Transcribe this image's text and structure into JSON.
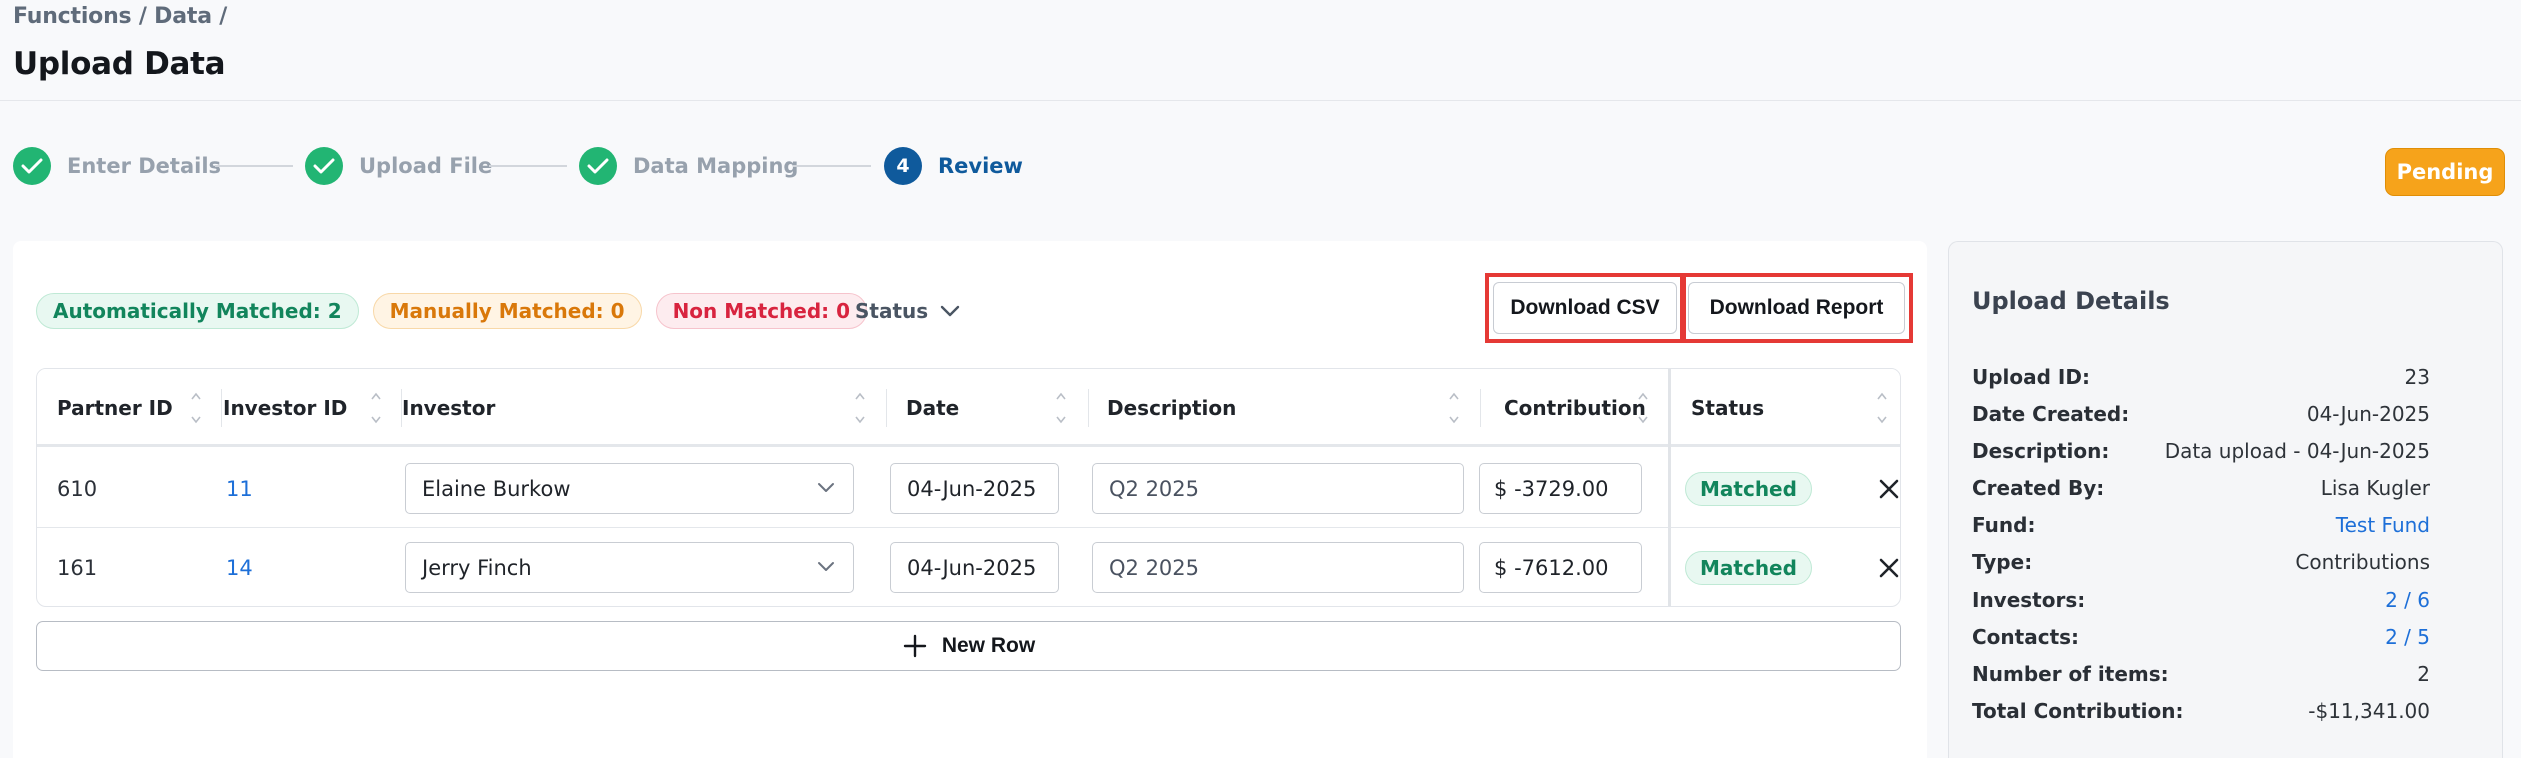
{
  "header": {
    "breadcrumb": "Functions / Data /",
    "title": "Upload Data"
  },
  "stepper": {
    "steps": [
      {
        "label": "Enter Details",
        "state": "done"
      },
      {
        "label": "Upload File",
        "state": "done"
      },
      {
        "label": "Data Mapping",
        "state": "done"
      },
      {
        "label": "Review",
        "state": "current",
        "number": "4"
      }
    ]
  },
  "status_badge": "Pending",
  "summary": {
    "auto_matched": "Automatically Matched: 2",
    "manual_matched": "Manually Matched: 0",
    "non_matched": "Non Matched: 0",
    "status_filter": "Status"
  },
  "actions": {
    "download_csv": "Download CSV",
    "download_report": "Download Report",
    "new_row": "New Row"
  },
  "table": {
    "columns": [
      "Partner ID",
      "Investor ID",
      "Investor",
      "Date",
      "Description",
      "Contribution",
      "Status"
    ],
    "rows": [
      {
        "partner_id": "610",
        "investor_id": "11",
        "investor": "Elaine Burkow",
        "date": "04-Jun-2025",
        "description": "Q2 2025",
        "currency": "$",
        "contribution": "-3729.00",
        "status": "Matched"
      },
      {
        "partner_id": "161",
        "investor_id": "14",
        "investor": "Jerry Finch",
        "date": "04-Jun-2025",
        "description": "Q2 2025",
        "currency": "$",
        "contribution": "-7612.00",
        "status": "Matched"
      }
    ]
  },
  "upload_details": {
    "title": "Upload Details",
    "items": [
      {
        "label": "Upload ID:",
        "value": "23"
      },
      {
        "label": "Date Created:",
        "value": "04-Jun-2025"
      },
      {
        "label": "Description:",
        "value": "Data upload - 04-Jun-2025"
      },
      {
        "label": "Created By:",
        "value": "Lisa Kugler"
      },
      {
        "label": "Fund:",
        "value": "Test Fund"
      },
      {
        "label": "Type:",
        "value": "Contributions"
      },
      {
        "label": "Investors:",
        "value": "2 / 6"
      },
      {
        "label": "Contacts:",
        "value": "2 / 5"
      },
      {
        "label": "Number of items:",
        "value": "2"
      },
      {
        "label": "Total Contribution:",
        "value": "-$11,341.00"
      }
    ]
  },
  "colors": {
    "success": "#22b573",
    "primary": "#0f5a9c",
    "pending": "#f6a31b",
    "link": "#1d6fd8",
    "highlight": "#e53935"
  }
}
